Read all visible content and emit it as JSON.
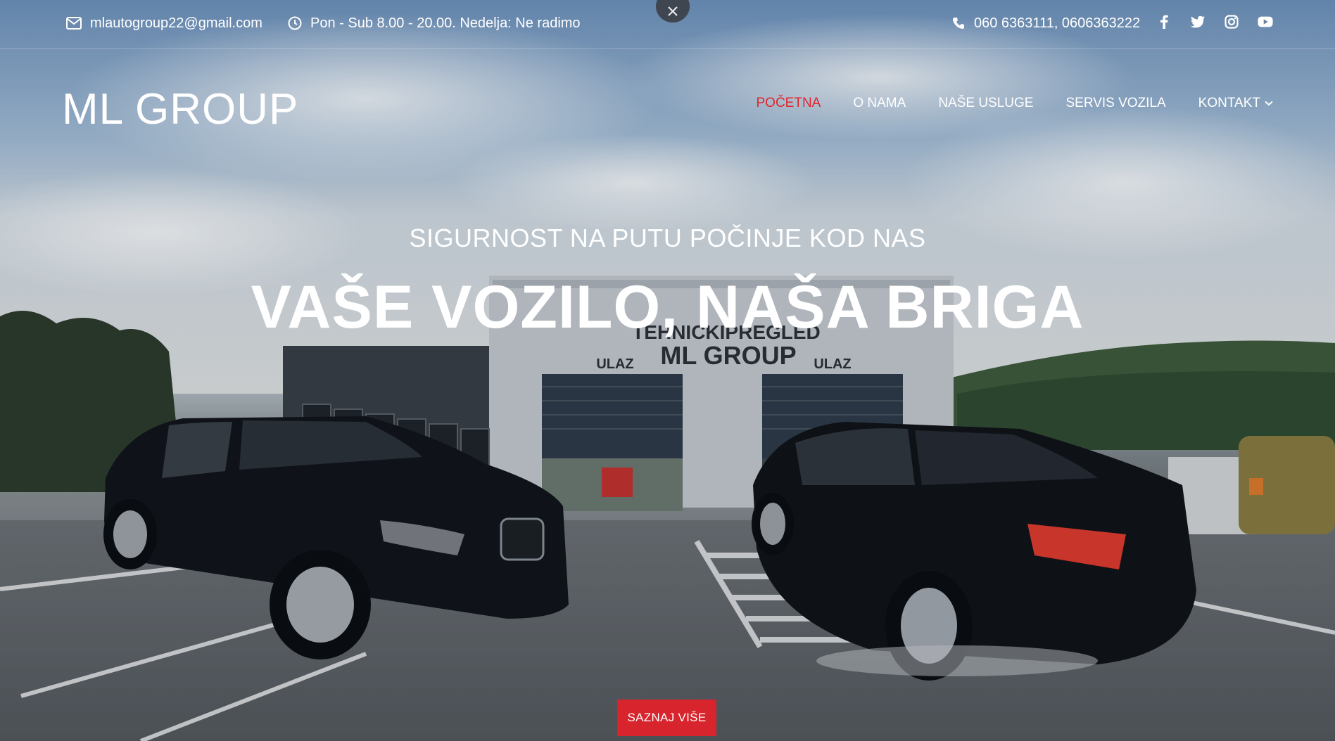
{
  "topbar": {
    "email": "mlautogroup22@gmail.com",
    "hours": "Pon - Sub 8.00 - 20.00. Nedelja: Ne radimo",
    "phone": "060 6363111, 0606363222",
    "social": [
      "facebook-icon",
      "twitter-icon",
      "instagram-icon",
      "youtube-icon"
    ]
  },
  "header": {
    "logo": "ML GROUP",
    "nav": [
      {
        "label": "POČETNA"
      },
      {
        "label": "O NAMA"
      },
      {
        "label": "NAŠE USLUGE"
      },
      {
        "label": "SERVIS VOZILA"
      },
      {
        "label": "KONTAKT"
      }
    ]
  },
  "hero": {
    "subtitle": "SIGURNOST NA PUTU POČINJE KOD NAS",
    "headline": "VAŠE VOZILO, NAŠA BRIGA",
    "cta": "SAZNAJ VIŠE",
    "building_sign_line1": "TEHNICKIPREGLED",
    "building_sign_line2": "ML GROUP",
    "entrance_label": "ULAZ"
  },
  "colors": {
    "accent": "#e3242b",
    "button": "#d8242c"
  }
}
